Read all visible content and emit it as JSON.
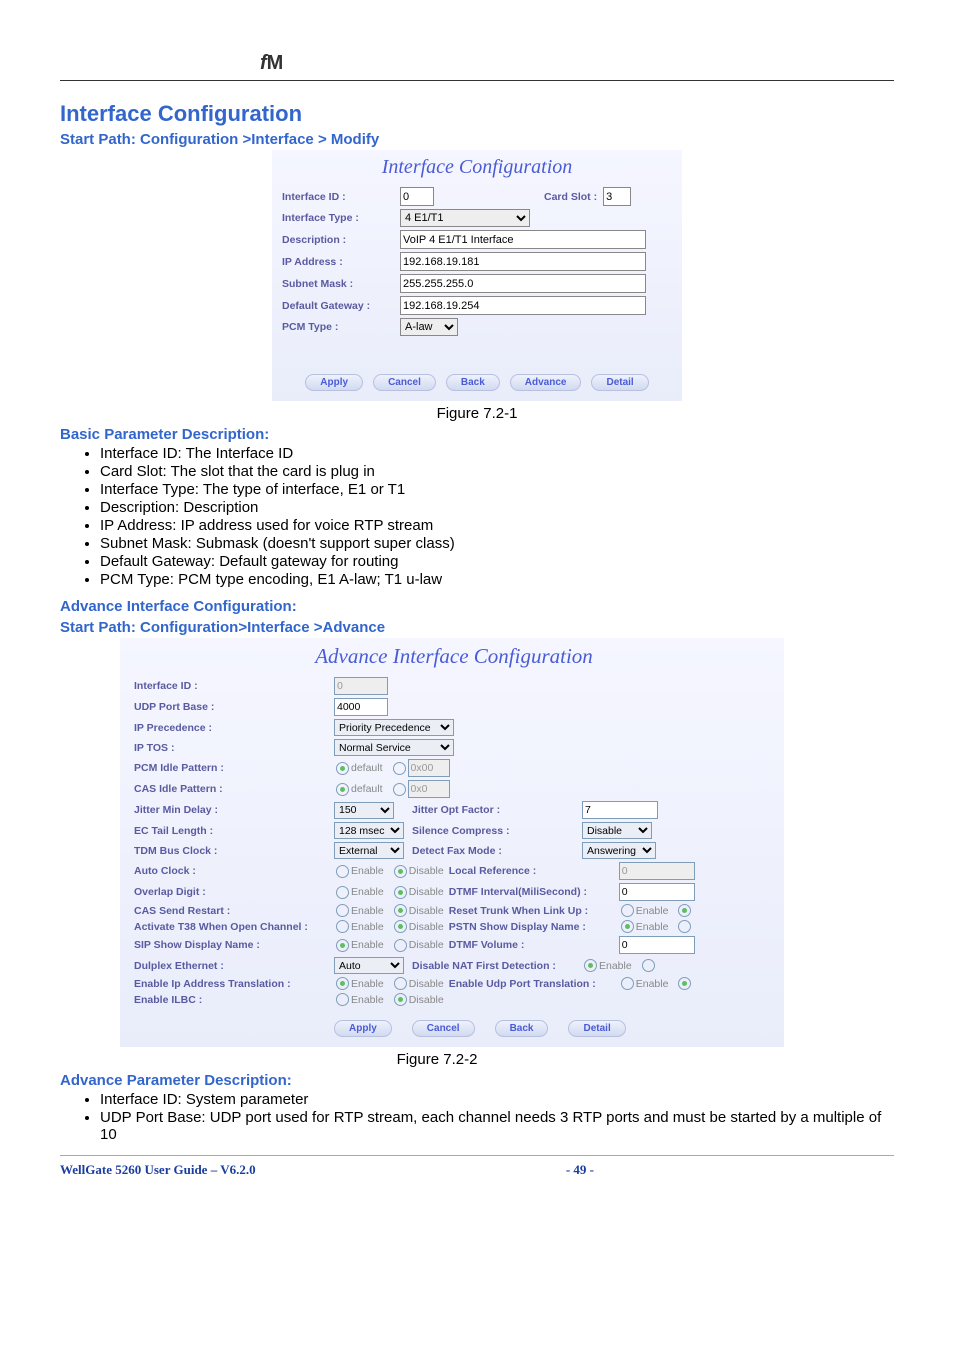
{
  "doc": {
    "title": "Interface Configuration",
    "path1": "Start Path: Configuration >Interface > Modify",
    "fig1": "Figure 7.2-1",
    "basic_hdr": "Basic Parameter Description:",
    "basic_items": [
      "Interface ID: The Interface ID",
      "Card Slot: The slot that the card is plug in",
      "Interface Type: The type of interface, E1 or T1",
      "Description: Description",
      "IP Address: IP address used for voice RTP stream",
      "Subnet Mask: Submask (doesn't support super class)",
      "Default Gateway: Default gateway for routing",
      "PCM Type: PCM type encoding, E1 A-law; T1 u-law"
    ],
    "adv_hdr1": "Advance Interface Configuration:",
    "adv_hdr2": "Start Path: Configuration>Interface >Advance",
    "fig2": "Figure 7.2-2",
    "adv_param_hdr": "Advance Parameter Description:",
    "adv_items": [
      "Interface ID: System parameter",
      "UDP Port Base: UDP port used for RTP stream, each channel needs 3 RTP ports and must be started by a multiple of 10"
    ]
  },
  "panel1": {
    "title": "Interface Configuration",
    "labels": {
      "iid": "Interface ID :",
      "cardslot": "Card Slot :",
      "itype": "Interface Type :",
      "desc": "Description :",
      "ip": "IP Address :",
      "mask": "Subnet Mask :",
      "gw": "Default Gateway :",
      "pcm": "PCM Type :"
    },
    "values": {
      "iid": "0",
      "cardslot": "3",
      "itype": "4 E1/T1",
      "desc": "VoIP 4 E1/T1 Interface",
      "ip": "192.168.19.181",
      "mask": "255.255.255.0",
      "gw": "192.168.19.254",
      "pcm": "A-law"
    },
    "buttons": {
      "apply": "Apply",
      "cancel": "Cancel",
      "back": "Back",
      "advance": "Advance",
      "detail": "Detail"
    }
  },
  "panel2": {
    "title": "Advance Interface Configuration",
    "labels": {
      "iid": "Interface ID :",
      "udp": "UDP Port Base :",
      "ipprec": "IP Precedence :",
      "iptos": "IP TOS :",
      "pcmidle": "PCM Idle Pattern :",
      "casidle": "CAS Idle Pattern :",
      "jmin": "Jitter Min Delay :",
      "ectail": "EC Tail Length :",
      "tdmbus": "TDM Bus Clock :",
      "autoclk": "Auto Clock :",
      "overlap": "Overlap Digit :",
      "cassend": "CAS Send Restart :",
      "t38open": "Activate T38 When Open Channel :",
      "sipshow": "SIP Show Display Name :",
      "dulplex": "Dulplex Ethernet :",
      "ipaddrtrans": "Enable Ip Address Translation :",
      "ilbc": "Enable ILBC :",
      "jopt": "Jitter Opt Factor :",
      "silence": "Silence Compress :",
      "faxmode": "Detect Fax Mode :",
      "localref": "Local Reference :",
      "dtmfint": "DTMF Interval(MiliSecond) :",
      "resettrunk": "Reset Trunk When Link Up :",
      "pstnshow": "PSTN Show Display Name :",
      "dtmfvol": "DTMF Volume :",
      "disnat": "Disable NAT First Detection :",
      "udptrans": "Enable Udp Port Translation :"
    },
    "values": {
      "iid": "0",
      "udp": "4000",
      "ipprec": "Priority Precedence",
      "iptos": "Normal Service",
      "pcmidle_hex": "0x00",
      "casidle_hex": "0x0",
      "jmin": "150",
      "ectail": "128 msec",
      "tdmbus": "External",
      "dulplex": "Auto",
      "jopt": "7",
      "silence": "Disable",
      "faxmode": "Answering Fa",
      "localref": "0",
      "dtmfint": "0",
      "dtmfvol": "0"
    },
    "radio": {
      "default": "default",
      "enable": "Enable",
      "disable": "Disable"
    },
    "buttons": {
      "apply": "Apply",
      "cancel": "Cancel",
      "back": "Back",
      "detail": "Detail"
    }
  },
  "footer": {
    "left": "WellGate 5260 User Guide – V6.2.0",
    "page": "- 49 -"
  }
}
